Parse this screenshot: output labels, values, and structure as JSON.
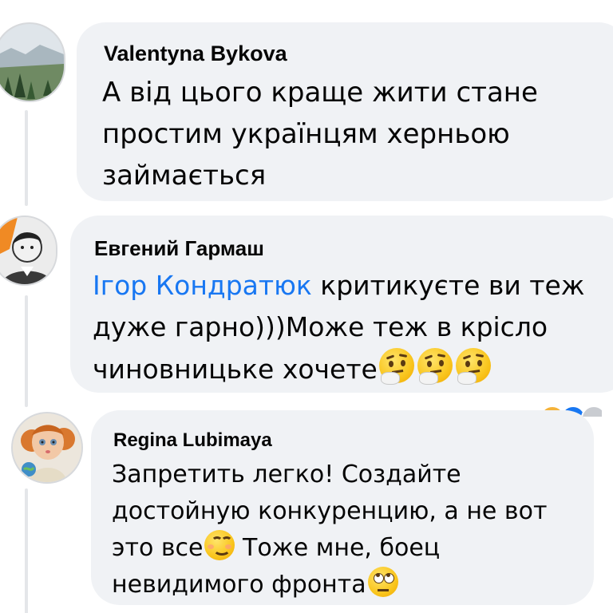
{
  "comments": [
    {
      "author": "Valentyna Bykova",
      "lines": [
        "А від цього краще жити стане",
        "простим українцям херньою",
        "займається"
      ]
    },
    {
      "author": "Евгений Гармаш",
      "mention": "Ігор Кондратюк",
      "line1_rest": " критикуєте ви теж",
      "lines": [
        "дуже гарно)))Може теж в крісло",
        "чиновницьке хочете"
      ]
    },
    {
      "author": "Regina Lubimaya",
      "lines": [
        "Запретить легко! Создайте",
        "достойную конкуренцию, а не вот",
        "это все",
        " Тоже мне, боец",
        "невидимого фронта"
      ]
    }
  ],
  "icons": {
    "thinking": "thinking-face-emoji",
    "smiling": "smiling-face-emoji",
    "eye_roll": "eye-roll-emoji"
  },
  "colors": {
    "bubble": "#f0f2f5",
    "mention": "#1877f2",
    "text": "#050505"
  }
}
